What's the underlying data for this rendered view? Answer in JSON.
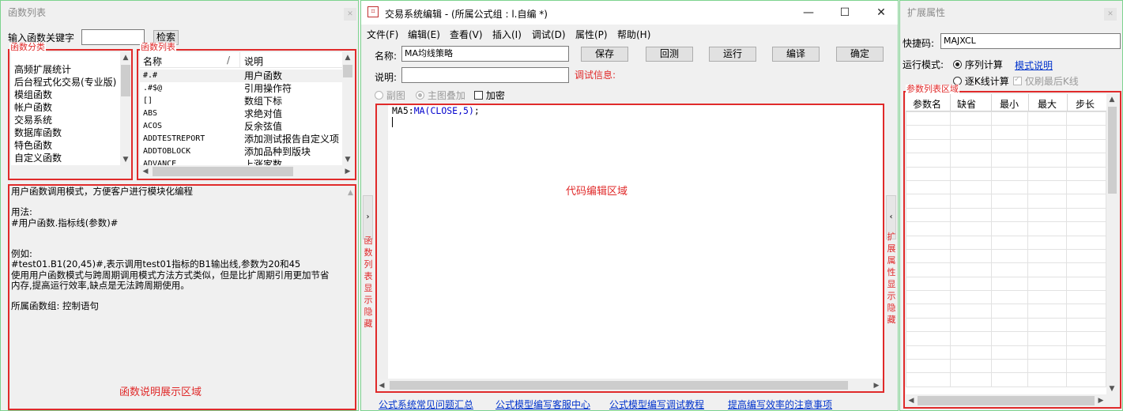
{
  "left": {
    "title": "函数列表",
    "search_label": "输入函数关键字",
    "search_value": "",
    "search_button": "检索",
    "category_box_label": "函数分类",
    "categories": [
      "高频扩展统计",
      "后台程式化交易(专业版)",
      "模组函数",
      "帐户函数",
      "交易系统",
      "数据库函数",
      "特色函数",
      "自定义函数"
    ],
    "list_box_label": "函数列表",
    "list_headers": [
      "名称",
      "说明"
    ],
    "functions": [
      {
        "name": "#.#",
        "desc": "用户函数"
      },
      {
        "name": ".#$@",
        "desc": "引用操作符"
      },
      {
        "name": "[]",
        "desc": "数组下标"
      },
      {
        "name": "ABS",
        "desc": "求绝对值"
      },
      {
        "name": "ACOS",
        "desc": "反余弦值"
      },
      {
        "name": "ADDTESTREPORT",
        "desc": "添加测试报告自定义项"
      },
      {
        "name": "ADDTOBLOCK",
        "desc": "添加品种到版块"
      },
      {
        "name": "ADVANCE",
        "desc": "上涨家数"
      }
    ],
    "desc_lines": [
      "用户函数调用模式，方便客户进行模块化编程",
      "",
      "用法:",
      "#用户函数.指标线(参数)#",
      "",
      "",
      "例如:",
      "#test01.B1(20,45)#,表示调用test01指标的B1输出线,参数为20和45",
      "使用用户函数模式与跨周期调用模式方法方式类似，但是比扩周期引用更加节省",
      "内存,提高运行效率,缺点是无法跨周期使用。",
      "",
      "所属函数组: 控制语句"
    ],
    "desc_area_label": "函数说明展示区域"
  },
  "middle": {
    "title": "交易系统编辑 - (所属公式组 : l.自编 *)",
    "menu": [
      "文件(F)",
      "编辑(E)",
      "查看(V)",
      "插入(I)",
      "调试(D)",
      "属性(P)",
      "帮助(H)"
    ],
    "name_label": "名称:",
    "name_value": "MA均线策略",
    "buttons": [
      "保存",
      "回测",
      "运行",
      "编译",
      "确定"
    ],
    "desc_label": "说明:",
    "desc_value": "",
    "debug_label": "调试信息:",
    "option_subchart": "副图",
    "option_main_overlay": "主图叠加",
    "option_encrypt": "加密",
    "code_prefix": "MA5:",
    "code_func": "MA(CLOSE,5)",
    "code_suffix": ";",
    "code_area_label": "代码编辑区域",
    "left_toggle_label": "函数列表显示隐藏",
    "right_toggle_label": "扩展属性显示隐藏",
    "links": [
      "公式系统常见问题汇总",
      "公式模型编写客服中心",
      "公式模型编写调试教程",
      "提高编写效率的注意事项"
    ]
  },
  "right": {
    "title": "扩展属性",
    "shortcut_label": "快捷码:",
    "shortcut_value": "MAJXCL",
    "run_mode_label": "运行模式:",
    "mode_sequence": "序列计算",
    "mode_desc_link": "模式说明",
    "mode_kline": "逐K线计算",
    "only_last_label": "仅刷最后K线",
    "param_area_label": "参数列表区域",
    "param_headers": [
      "参数名",
      "缺省",
      "最小",
      "最大",
      "步长"
    ]
  }
}
